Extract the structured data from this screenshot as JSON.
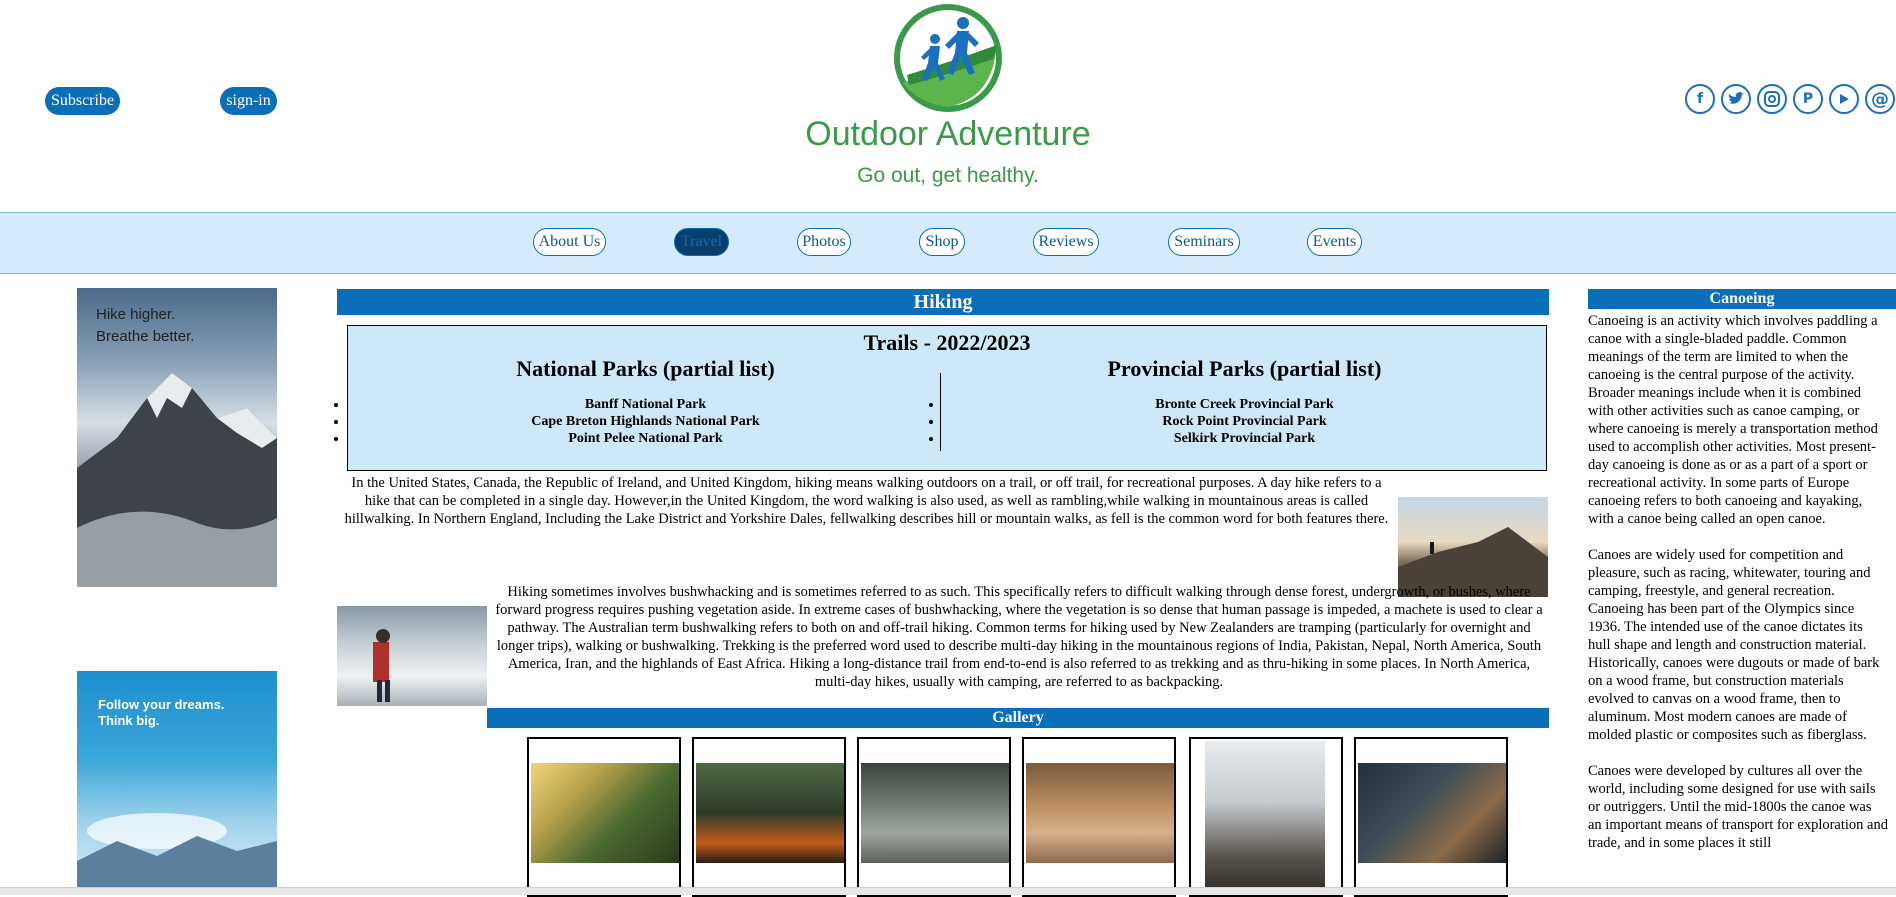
{
  "header": {
    "subscribe_label": "Subscribe",
    "signin_label": "sign-in",
    "site_title": "Outdoor Adventure",
    "tagline": "Go out, get healthy.",
    "social_icons": [
      "facebook-icon",
      "twitter-icon",
      "instagram-icon",
      "pinterest-icon",
      "youtube-icon",
      "email-icon"
    ],
    "brand_green": "#3a9a4a",
    "brand_blue": "#0a6eb8"
  },
  "nav": {
    "items": [
      {
        "label": "About Us"
      },
      {
        "label": "Travel",
        "active": true
      },
      {
        "label": "Photos"
      },
      {
        "label": "Shop"
      },
      {
        "label": "Reviews"
      },
      {
        "label": "Seminars"
      },
      {
        "label": "Events"
      }
    ]
  },
  "left_ads": {
    "ad1_text_1": "Hike higher.",
    "ad1_text_2": "Breathe better.",
    "ad2_text_1": "Follow your dreams.",
    "ad2_text_2": "Think big."
  },
  "main": {
    "heading": "Hiking",
    "trails_title": "Trails - 2022/2023",
    "national_title": "National Parks (partial list)",
    "national_parks": [
      "Banff National Park",
      "Cape Breton Highlands National Park",
      "Point Pelee National Park"
    ],
    "provincial_title": "Provincial Parks (partial list)",
    "provincial_parks": [
      "Bronte Creek Provincial Park",
      "Rock Point Provincial Park",
      "Selkirk Provincial Park"
    ],
    "paragraph1": "In the United States, Canada, the Republic of Ireland, and United Kingdom, hiking means walking outdoors on a trail, or off trail, for recreational purposes. A day hike refers to a hike that can be completed in a single day. However,in the United Kingdom, the word walking is also used, as well as rambling,while walking in mountainous areas is called hillwalking. In Northern England, Including the Lake District and Yorkshire Dales, fellwalking describes hill or mountain walks, as fell is the common word for both features there.",
    "paragraph2": "Hiking sometimes involves bushwhacking and is sometimes referred to as such. This specifically refers to difficult walking through dense forest, undergrowth, or bushes, where forward progress requires pushing vegetation aside. In extreme cases of bushwhacking, where the vegetation is so dense that human passage is impeded, a machete is used to clear a pathway. The Australian term bushwalking refers to both on and off-trail hiking. Common terms for hiking used by New Zealanders are tramping (particularly for overnight and longer trips), walking or bushwalking. Trekking is the preferred word used to describe multi-day hiking in the mountainous regions of India, Pakistan, Nepal, North America, South America, Iran, and the highlands of East Africa. Hiking a long-distance trail from end-to-end is also referred to as trekking and as thru-hiking in some places. In North America, multi-day hikes, usually with camping, are referred to as backpacking.",
    "gallery_heading": "Gallery"
  },
  "sidebar": {
    "heading": "Canoeing",
    "p1": "Canoeing is an activity which involves paddling a canoe with a single-bladed paddle. Common meanings of the term are limited to when the canoeing is the central purpose of the activity. Broader meanings include when it is combined with other activities such as canoe camping, or where canoeing is merely a transportation method used to accomplish other activities. Most present-day canoeing is done as or as a part of a sport or recreational activity. In some parts of Europe canoeing refers to both canoeing and kayaking, with a canoe being called an open canoe.",
    "p2": "Canoes are widely used for competition and pleasure, such as racing, whitewater, touring and camping, freestyle, and general recreation. Canoeing has been part of the Olympics since 1936. The intended use of the canoe dictates its hull shape and length and construction material. Historically, canoes were dugouts or made of bark on a wood frame, but construction materials evolved to canvas on a wood frame, then to aluminum. Most modern canoes are made of molded plastic or composites such as fiberglass.",
    "p3": "Canoes were developed by cultures all over the world, including some designed for use with sails or outriggers. Until the mid-1800s the canoe was an important means of transport for exploration and trade, and in some places it still"
  }
}
